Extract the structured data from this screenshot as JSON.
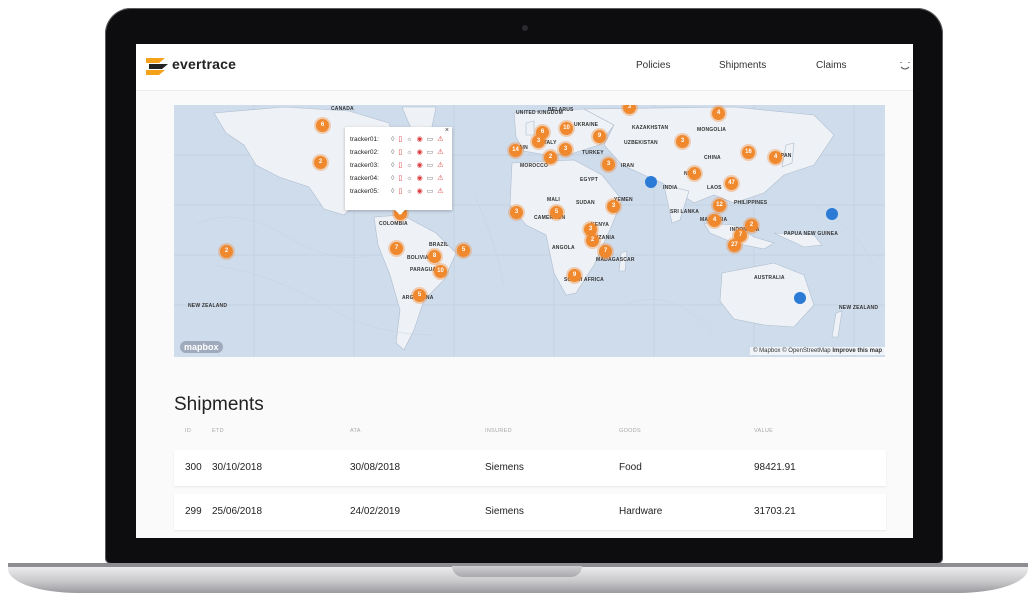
{
  "app": {
    "brand": "evertrace"
  },
  "nav": {
    "items": [
      "Policies",
      "Shipments",
      "Claims"
    ]
  },
  "map": {
    "attribution": "© Mapbox © OpenStreetMap",
    "improve_link": "Improve this map",
    "mapbox_logo": "mapbox",
    "labels": [
      "CANADA",
      "UNITED KINGDOM",
      "BELARUS",
      "UKRAINE",
      "KAZAKHSTAN",
      "MONGOLIA",
      "ITALY",
      "UZBEKISTAN",
      "TURKEY",
      "CHINA",
      "MOROCCO",
      "IRAN",
      "NEPAL",
      "EGYPT",
      "INDIA",
      "LAOS",
      "MALI",
      "SUDAN",
      "YEMEN",
      "PHILIPPINES",
      "CAMEROON",
      "SRI LANKA",
      "MALAYSIA",
      "COLOMBIA",
      "KENYA",
      "TANZANIA",
      "INDONESIA",
      "PAPUA NEW GUINEA",
      "BRAZIL",
      "ANGOLA",
      "BOLIVIA",
      "MADAGASCAR",
      "PARAGUAY",
      "AUSTRALIA",
      "SOUTH AFRICA",
      "ARGENTINA",
      "NEW ZEALAND",
      "NEW ZEALAND",
      "JAPAN",
      "SPAIN"
    ],
    "clusters": [
      "6",
      "2",
      "3",
      "4",
      "10",
      "6",
      "14",
      "3",
      "9",
      "2",
      "3",
      "16",
      "3",
      "4",
      "3",
      "6",
      "47",
      "12",
      "3",
      "5",
      "3",
      "3",
      "4",
      "2",
      "7",
      "27",
      "5",
      "2",
      "10",
      "7",
      "8",
      "2",
      "9",
      "7",
      "5",
      "2"
    ],
    "popup": {
      "close": "×",
      "trackers": [
        {
          "label": "tracker01:",
          "icons": "◊ ▯ ☼ ◉ ▭ ⚠"
        },
        {
          "label": "tracker02:",
          "icons": "◊ ▯ ☼ ◉ ▭ ⚠"
        },
        {
          "label": "tracker03:",
          "icons": "◊ ▯ ☼ ◉ ▭ ⚠"
        },
        {
          "label": "tracker04:",
          "icons": "◊ ▯ ☼ ◉ ▭ ⚠"
        },
        {
          "label": "tracker05:",
          "icons": "◊ ▯ ☼ ◉ ▭ ⚠"
        }
      ]
    }
  },
  "shipments": {
    "title": "Shipments",
    "columns": [
      "ID",
      "ETD",
      "ATA",
      "INSURED",
      "GOODS",
      "VALUE"
    ],
    "rows": [
      {
        "id": "300",
        "etd": "30/10/2018",
        "ata": "30/08/2018",
        "insured": "Siemens",
        "goods": "Food",
        "value": "98421.91"
      },
      {
        "id": "299",
        "etd": "25/06/2018",
        "ata": "24/02/2019",
        "insured": "Siemens",
        "goods": "Hardware",
        "value": "31703.21"
      }
    ]
  },
  "colors": {
    "accent": "#f0882d",
    "marker_blue": "#2a7ad6",
    "ocean": "#cfdceb",
    "land": "#eef1f5"
  }
}
